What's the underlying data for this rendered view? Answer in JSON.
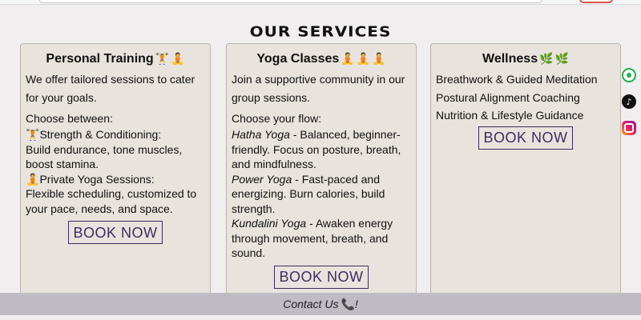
{
  "section_title": "OUR SERVICES",
  "icons": {
    "dumbbell": "🏋",
    "yoga": "🧘",
    "leaf": "🌿",
    "phone": "📞",
    "tiktok_glyph": "♪"
  },
  "services": {
    "personal_training": {
      "title": "Personal Training",
      "intro": "We offer tailored sessions to cater for your goals.",
      "choose": "Choose between:",
      "option1_head": "Strength & Conditioning:",
      "option1_body": "Build endurance, tone muscles, boost stamina.",
      "option2_head": "Private Yoga Sessions:",
      "option2_body": "Flexible scheduling, customized to your pace, needs, and space.",
      "button": "BOOK NOW"
    },
    "yoga_classes": {
      "title": "Yoga Classes",
      "intro": "Join a supportive community in our group sessions.",
      "choose": "Choose your flow:",
      "flows": [
        {
          "name": "Hatha Yoga",
          "desc": " - Balanced, beginner-friendly. Focus on posture, breath, and mindfulness."
        },
        {
          "name": "Power Yoga",
          "desc": " - Fast-paced and energizing. Burn calories, build strength."
        },
        {
          "name": "Kundalini Yoga",
          "desc": " - Awaken energy through movement, breath, and sound."
        }
      ],
      "button": "BOOK NOW"
    },
    "wellness": {
      "title": "Wellness",
      "items": [
        "Breathwork & Guided Meditation",
        "Postural Alignment Coaching",
        "Nutrition & Lifestyle Guidance"
      ],
      "button": "BOOK NOW"
    }
  },
  "footer": {
    "contact_label": "Contact Us",
    "suffix": "!"
  }
}
